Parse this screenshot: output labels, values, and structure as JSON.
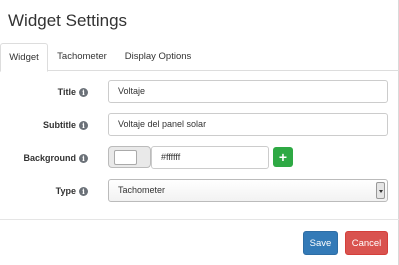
{
  "modal": {
    "title": "Widget Settings"
  },
  "tabs": [
    {
      "label": "Widget",
      "active": true
    },
    {
      "label": "Tachometer",
      "active": false
    },
    {
      "label": "Display Options",
      "active": false
    }
  ],
  "form": {
    "title_label": "Title",
    "title_value": "Voltaje",
    "subtitle_label": "Subtitle",
    "subtitle_value": "Voltaje del panel solar",
    "background_label": "Background",
    "background_value": "#ffffff",
    "type_label": "Type",
    "type_value": "Tachometer",
    "info_glyph": "i",
    "add_glyph": "+"
  },
  "footer": {
    "save_label": "Save",
    "cancel_label": "Cancel"
  },
  "colors": {
    "save": "#337ab7",
    "cancel": "#d9534f",
    "add": "#2ea944",
    "swatch": "#ffffff"
  },
  "icons": {
    "info": "info-icon",
    "add": "plus-icon",
    "dropdown": "chevron-down-icon"
  }
}
